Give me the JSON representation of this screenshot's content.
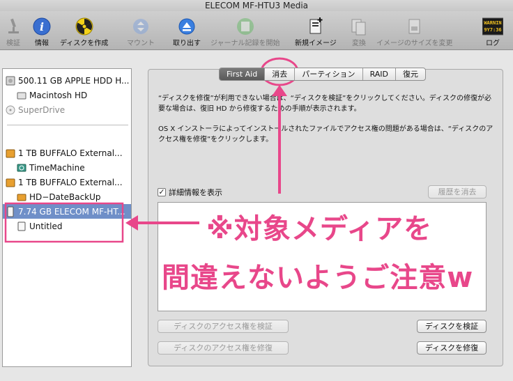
{
  "window": {
    "title": "ELECOM MF-HTU3 Media"
  },
  "toolbar": {
    "items": [
      {
        "label": "検証",
        "icon": "microscope-icon",
        "enabled": false
      },
      {
        "label": "情報",
        "icon": "info-icon",
        "enabled": true
      },
      {
        "label": "ディスクを作成",
        "icon": "burn-icon",
        "enabled": true
      },
      {
        "label": "マウント",
        "icon": "mount-icon",
        "enabled": false
      },
      {
        "label": "取り出す",
        "icon": "eject-icon",
        "enabled": true
      },
      {
        "label": "ジャーナル記録を開始",
        "icon": "journal-icon",
        "enabled": false
      },
      {
        "label": "新規イメージ",
        "icon": "new-image-icon",
        "enabled": true
      },
      {
        "label": "変換",
        "icon": "convert-icon",
        "enabled": false
      },
      {
        "label": "イメージのサイズを変更",
        "icon": "resize-image-icon",
        "enabled": false
      },
      {
        "label": "ログ",
        "icon": "log-icon",
        "enabled": true,
        "badge": "WARNIN\n9Y7:36"
      }
    ]
  },
  "sidebar": {
    "items": [
      {
        "label": "500.11 GB APPLE HDD H...",
        "kind": "disk"
      },
      {
        "label": "Macintosh HD",
        "kind": "volume"
      },
      {
        "label": "SuperDrive",
        "kind": "optical"
      },
      {
        "label": "1 TB BUFFALO External...",
        "kind": "external-disk"
      },
      {
        "label": "TimeMachine",
        "kind": "timemachine"
      },
      {
        "label": "1 TB BUFFALO External...",
        "kind": "external-disk"
      },
      {
        "label": "HD−DateBackUp",
        "kind": "volume"
      },
      {
        "label": "7.74 GB ELECOM MF-HT...",
        "kind": "usb-disk"
      },
      {
        "label": "Untitled",
        "kind": "volume"
      }
    ]
  },
  "tabs": [
    "First Aid",
    "消去",
    "パーティション",
    "RAID",
    "復元"
  ],
  "first_aid": {
    "para1": "“ディスクを修復”が利用できない場合は、“ディスクを検証”をクリックしてください。ディスクの修復が必要な場合は、復旧 HD から修復するための手順が表示されます。",
    "para2": "OS X インストーラによってインストールされたファイルでアクセス権の問題がある場合は、“ディスクのアクセス権を修復”をクリックします。",
    "show_details": "詳細情報を表示",
    "clear_history": "履歴を消去",
    "verify_permissions": "ディスクのアクセス権を検証",
    "repair_permissions": "ディスクのアクセス権を修復",
    "verify_disk": "ディスクを検証",
    "repair_disk": "ディスクを修復"
  },
  "annotation": {
    "line1": "※対象メディアを",
    "line2": "間違えないようご注意w",
    "color": "#e8478a"
  }
}
